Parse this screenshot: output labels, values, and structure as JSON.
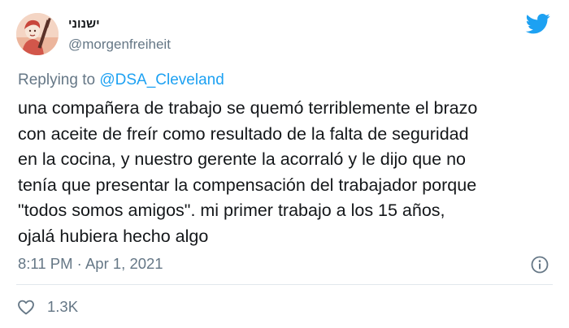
{
  "author": {
    "display_name": "ישנוני",
    "handle": "@morgenfreiheit"
  },
  "reply": {
    "prefix": "Replying to",
    "mention": "@DSA_Cleveland"
  },
  "tweet": {
    "lines": [
      "una compañera de trabajo se quemó terriblemente el brazo",
      "con aceite de freír como resultado de la falta de seguridad",
      "en la cocina, y nuestro gerente la acorraló y le dijo que no",
      "tenía que presentar la compensación del trabajador porque",
      "\"todos somos amigos\". mi primer trabajo a los 15 años,",
      "ojalá hubiera hecho algo"
    ],
    "timestamp": "8:11 PM · Apr 1, 2021"
  },
  "engagement": {
    "likes": "1.3K"
  },
  "icons": {
    "brand": "twitter-bird-icon",
    "info": "info-icon",
    "like": "heart-icon"
  },
  "colors": {
    "brand_blue": "#1da1f2",
    "secondary_text": "#657786",
    "primary_text": "#14171a",
    "divider": "#e1e8ed"
  }
}
